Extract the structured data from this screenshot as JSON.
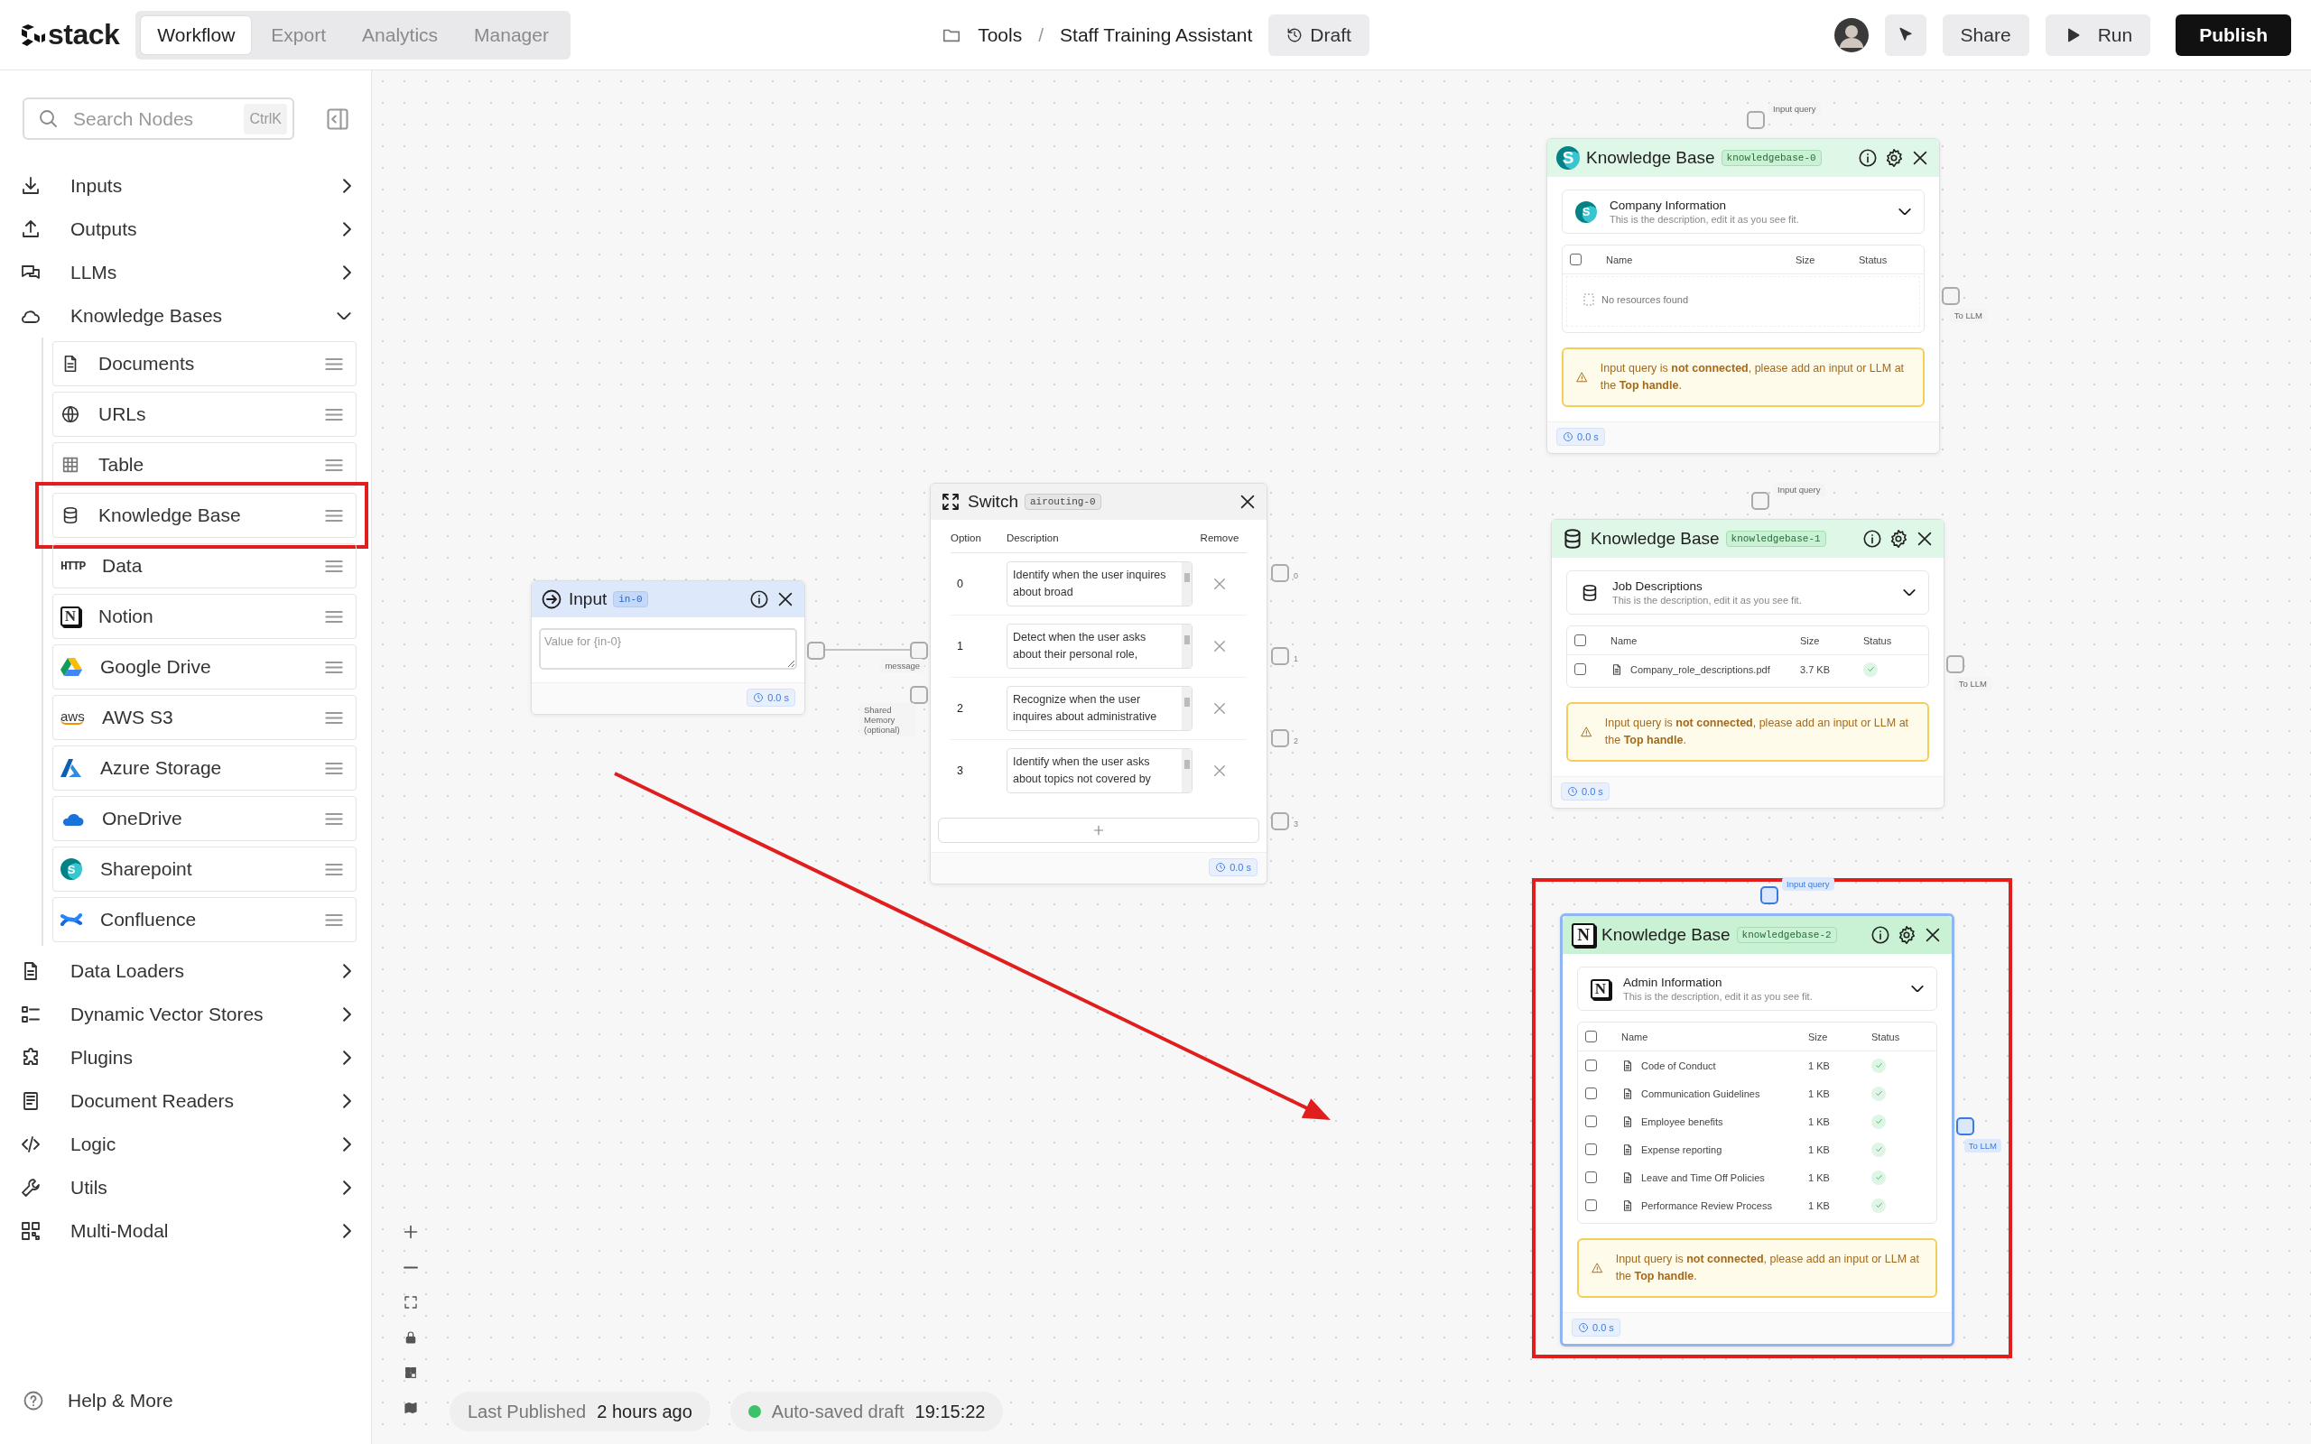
{
  "header": {
    "logo": "stack",
    "tabs": [
      {
        "label": "Workflow",
        "selected": true
      },
      {
        "label": "Export",
        "selected": false
      },
      {
        "label": "Analytics",
        "selected": false
      },
      {
        "label": "Manager",
        "selected": false
      }
    ],
    "breadcrumb": {
      "folder": "Tools",
      "separator": "/",
      "project": "Staff Training Assistant"
    },
    "draft_button": "Draft",
    "share_button": "Share",
    "run_button": "Run",
    "publish_button": "Publish"
  },
  "sidebar": {
    "search": {
      "placeholder": "Search Nodes",
      "shortcut": "CtrlK"
    },
    "categories": [
      {
        "label": "Inputs",
        "expanded": false
      },
      {
        "label": "Outputs",
        "expanded": false
      },
      {
        "label": "LLMs",
        "expanded": false
      },
      {
        "label": "Knowledge Bases",
        "expanded": true,
        "children": [
          {
            "label": "Documents",
            "highlighted": false
          },
          {
            "label": "URLs",
            "highlighted": false
          },
          {
            "label": "Table",
            "highlighted": false
          },
          {
            "label": "Knowledge Base",
            "highlighted": true
          },
          {
            "label": "Data",
            "logo_text": "HTTP",
            "highlighted": false
          },
          {
            "label": "Notion",
            "logo_text": "N",
            "highlighted": false
          },
          {
            "label": "Google Drive",
            "highlighted": false
          },
          {
            "label": "AWS S3",
            "logo_text": "aws",
            "highlighted": false
          },
          {
            "label": "Azure Storage",
            "highlighted": false
          },
          {
            "label": "OneDrive",
            "highlighted": false
          },
          {
            "label": "Sharepoint",
            "logo_text": "S",
            "highlighted": false
          },
          {
            "label": "Confluence",
            "highlighted": false
          }
        ]
      },
      {
        "label": "Data Loaders",
        "expanded": false
      },
      {
        "label": "Dynamic Vector Stores",
        "expanded": false
      },
      {
        "label": "Plugins",
        "expanded": false
      },
      {
        "label": "Document Readers",
        "expanded": false
      },
      {
        "label": "Logic",
        "expanded": false
      },
      {
        "label": "Utils",
        "expanded": false
      },
      {
        "label": "Multi-Modal",
        "expanded": false
      }
    ],
    "help": "Help & More"
  },
  "canvas": {
    "nodes": [
      {
        "kind": "input",
        "title": "Input",
        "tag": "in-0",
        "placeholder": "Value for {in-0}",
        "timer": "0.0 s"
      },
      {
        "kind": "switch",
        "title": "Switch",
        "tag": "airouting-0",
        "columns": [
          "Option",
          "Description",
          "Remove"
        ],
        "options": [
          {
            "option": "0",
            "description": "Identify when the user inquires about broad"
          },
          {
            "option": "1",
            "description": "Detect when the user asks about their personal role,"
          },
          {
            "option": "2",
            "description": "Recognize when the user inquires about administrative"
          },
          {
            "option": "3",
            "description": "Identify when the user asks about topics not covered by"
          }
        ],
        "timer": "0.0 s",
        "input_handles": [
          "message",
          "Shared Memory (optional)"
        ],
        "output_handles": [
          "0",
          "1",
          "2",
          "3"
        ]
      },
      {
        "kind": "knowledge_base",
        "title": "Knowledge Base",
        "tag": "knowledgebase-0",
        "logo_text": "S",
        "selected": false,
        "highlighted": false,
        "source": {
          "title": "Company Information",
          "description": "This is the description, edit it as you see fit.",
          "logo_text": "S"
        },
        "columns": [
          "Name",
          "Size",
          "Status"
        ],
        "select_all_checked": false,
        "empty_text": "No resources found",
        "warning": "Input query is **not connected**, please add an input or LLM at the **Top handle**.",
        "timer": "0.0 s",
        "input_label": "Input query",
        "output_label": "To LLM"
      },
      {
        "kind": "knowledge_base",
        "title": "Knowledge Base",
        "tag": "knowledgebase-1",
        "selected": false,
        "highlighted": false,
        "source": {
          "title": "Job Descriptions",
          "description": "This is the description, edit it as you see fit."
        },
        "columns": [
          "Name",
          "Size",
          "Status"
        ],
        "select_all_checked": false,
        "files": [
          {
            "name": "Company_role_descriptions.pdf",
            "size": "3.7 KB",
            "checked": false,
            "ready": true
          }
        ],
        "warning": "Input query is **not connected**, please add an input or LLM at the **Top handle**.",
        "timer": "0.0 s",
        "input_label": "Input query",
        "output_label": "To LLM"
      },
      {
        "kind": "knowledge_base",
        "title": "Knowledge Base",
        "tag": "knowledgebase-2",
        "logo_text": "N",
        "selected": true,
        "highlighted": true,
        "source": {
          "title": "Admin Information",
          "description": "This is the description, edit it as you see fit.",
          "logo_text": "N"
        },
        "columns": [
          "Name",
          "Size",
          "Status"
        ],
        "select_all_checked": false,
        "files": [
          {
            "name": "Code of Conduct",
            "size": "1 KB",
            "checked": false,
            "ready": true
          },
          {
            "name": "Communication Guidelines",
            "size": "1 KB",
            "checked": false,
            "ready": true
          },
          {
            "name": "Employee benefits",
            "size": "1 KB",
            "checked": false,
            "ready": true
          },
          {
            "name": "Expense reporting",
            "size": "1 KB",
            "checked": false,
            "ready": true
          },
          {
            "name": "Leave and Time Off Policies",
            "size": "1 KB",
            "checked": false,
            "ready": true
          },
          {
            "name": "Performance Review Process",
            "size": "1 KB",
            "checked": false,
            "ready": true
          }
        ],
        "warning": "Input query is **not connected**, please add an input or LLM at the **Top handle**.",
        "timer": "0.0 s",
        "input_label": "Input query",
        "output_label": "To LLM"
      }
    ],
    "footer": {
      "published_label": "Last Published",
      "published_value": "2 hours ago",
      "saved": true,
      "autosave_label": "Auto-saved draft",
      "autosave_time": "19:15:22"
    }
  }
}
